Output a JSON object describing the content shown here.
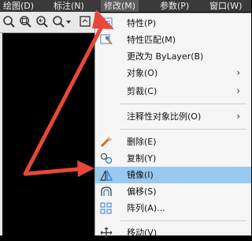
{
  "colors": {
    "menubar_bg": "#3a3a3a",
    "menu_bg": "#f5f5f5",
    "highlight": "#99c9ef",
    "arrow": "#e8473a",
    "canvas": "#000000"
  },
  "menubar": {
    "items": [
      {
        "label": "绘图(D)"
      },
      {
        "label": "标注(N)"
      },
      {
        "label": "修改(M)"
      },
      {
        "label": "参数(P)"
      },
      {
        "label": "窗口(W)"
      }
    ]
  },
  "toolbar": {
    "icons": [
      "zoom-realtime-icon",
      "zoom-window-icon",
      "zoom-previous-icon",
      "dropdown-icon"
    ]
  },
  "menu": {
    "items": [
      {
        "label": "特性(P)",
        "icon": "properties-icon"
      },
      {
        "label": "特性匹配(M)",
        "icon": "match-properties-icon"
      },
      {
        "label": "更改为 ByLayer(B)",
        "icon": ""
      },
      {
        "label": "对象(O)",
        "icon": "",
        "arrow": "›"
      },
      {
        "label": "剪裁(C)",
        "icon": "",
        "arrow": "›"
      },
      {
        "label": "注释性对象比例(O)",
        "icon": "",
        "arrow": "›"
      },
      {
        "label": "删除(E)",
        "icon": "erase-icon"
      },
      {
        "label": "复制(Y)",
        "icon": "copy-icon"
      },
      {
        "label": "镜像(I)",
        "icon": "mirror-icon"
      },
      {
        "label": "偏移(S)",
        "icon": "offset-icon"
      },
      {
        "label": "阵列(A)...",
        "icon": "array-icon"
      },
      {
        "label": "移动(V)",
        "icon": "move-icon"
      }
    ]
  }
}
